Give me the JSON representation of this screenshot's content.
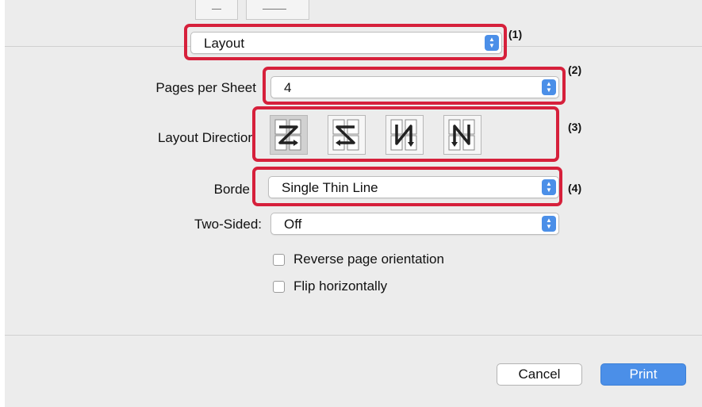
{
  "pane_selector": {
    "value": "Layout",
    "callout": "(1)"
  },
  "pages_per_sheet": {
    "label": "Pages per Sheet",
    "value": "4",
    "callout": "(2)"
  },
  "layout_direction": {
    "label": "Layout Directior",
    "callout": "(3)",
    "options": [
      "z-left-to-right-icon",
      "s-right-to-left-icon",
      "n-top-to-bottom-icon",
      "n-mirrored-icon"
    ],
    "selected_index": 0
  },
  "border": {
    "label": "Borde",
    "value": "Single Thin Line",
    "callout": "(4)"
  },
  "two_sided": {
    "label": "Two-Sided:",
    "value": "Off"
  },
  "options": {
    "reverse_label": "Reverse page orientation",
    "reverse_checked": false,
    "flip_label": "Flip horizontally",
    "flip_checked": false
  },
  "buttons": {
    "cancel": "Cancel",
    "print": "Print"
  },
  "colors": {
    "highlight": "#d6203b",
    "accent": "#4b8fe8",
    "dialog_bg": "#ececec"
  }
}
